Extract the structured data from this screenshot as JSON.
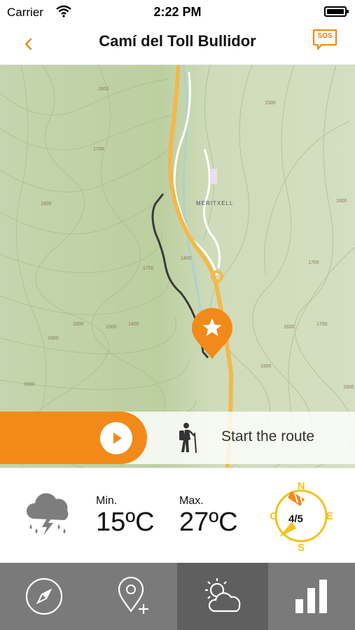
{
  "status_bar": {
    "carrier": "Carrier",
    "time": "2:22 PM"
  },
  "nav": {
    "title": "Camí del Toll Bullidor",
    "sos_label": "SOS"
  },
  "map": {
    "place_label": "MERITXELL",
    "contour_labels": [
      "1600",
      "1700",
      "1800",
      "1500",
      "1400",
      "1700",
      "1800",
      "1900",
      "1800",
      "1400",
      "1500",
      "1600",
      "1700",
      "1500",
      "1600",
      "1700",
      "1800"
    ]
  },
  "route": {
    "start_label": "Start the route"
  },
  "weather": {
    "min_label": "Min.",
    "min_value": "15ºC",
    "max_label": "Max.",
    "max_value": "27ºC",
    "wind_value": "4/5",
    "compass": {
      "n": "N",
      "e": "E",
      "s": "S",
      "o": "O"
    }
  },
  "tabs": [
    {
      "icon": "compass-icon",
      "active": false
    },
    {
      "icon": "add-location-icon",
      "active": false
    },
    {
      "icon": "weather-icon",
      "active": true
    },
    {
      "icon": "stats-icon",
      "active": false
    }
  ],
  "colors": {
    "accent": "#f28a1a",
    "road": "#f2b94c",
    "trail": "#3a3a3a",
    "tabbar": "#7a7a7a",
    "tab_active": "#5f5f5f",
    "map_bg": "#c9d8b4"
  }
}
